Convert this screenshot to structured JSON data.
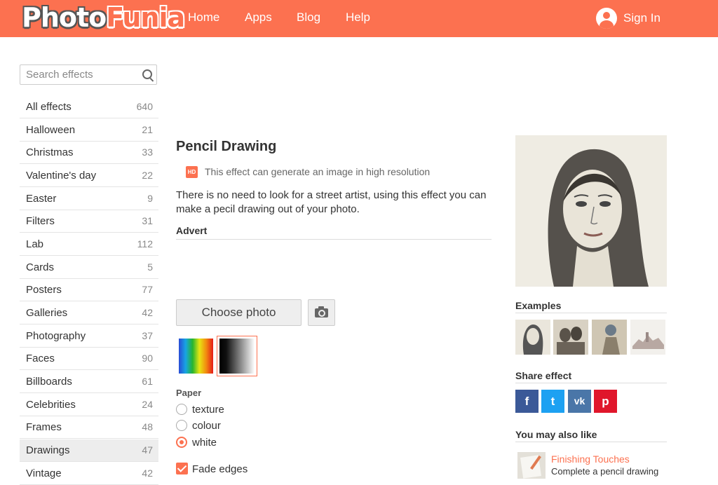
{
  "header": {
    "logo_part1": "Photo",
    "logo_part2": "Funia",
    "nav": [
      "Home",
      "Apps",
      "Blog",
      "Help"
    ],
    "signin_label": "Sign In",
    "accent_color": "#fc7150"
  },
  "sidebar": {
    "search_placeholder": "Search effects",
    "categories": [
      {
        "label": "All effects",
        "count": "640"
      },
      {
        "label": "Halloween",
        "count": "21"
      },
      {
        "label": "Christmas",
        "count": "33"
      },
      {
        "label": "Valentine's day",
        "count": "22"
      },
      {
        "label": "Easter",
        "count": "9"
      },
      {
        "label": "Filters",
        "count": "31"
      },
      {
        "label": "Lab",
        "count": "112"
      },
      {
        "label": "Cards",
        "count": "5"
      },
      {
        "label": "Posters",
        "count": "77"
      },
      {
        "label": "Galleries",
        "count": "42"
      },
      {
        "label": "Photography",
        "count": "37"
      },
      {
        "label": "Faces",
        "count": "90"
      },
      {
        "label": "Billboards",
        "count": "61"
      },
      {
        "label": "Celebrities",
        "count": "24"
      },
      {
        "label": "Frames",
        "count": "48"
      },
      {
        "label": "Drawings",
        "count": "47"
      },
      {
        "label": "Vintage",
        "count": "42"
      }
    ],
    "active_category": "Drawings"
  },
  "main": {
    "title": "Pencil Drawing",
    "hd_badge": "HD",
    "hd_text": "This effect can generate an image in high resolution",
    "description": "There is no need to look for a street artist, using this effect you can make a pecil drawing out of your photo.",
    "advert_label": "Advert",
    "choose_photo_label": "Choose photo",
    "paper_label": "Paper",
    "paper_options": [
      "texture",
      "colour",
      "white"
    ],
    "paper_selected": "white",
    "fade_edges_label": "Fade edges",
    "fade_edges_checked": true
  },
  "right": {
    "examples_title": "Examples",
    "share_title": "Share effect",
    "share_buttons": [
      {
        "name": "facebook",
        "glyph": "f",
        "color": "#3b5998"
      },
      {
        "name": "twitter",
        "glyph": "t",
        "color": "#1da1f2"
      },
      {
        "name": "vk",
        "glyph": "vk",
        "color": "#4a76a8"
      },
      {
        "name": "pinterest",
        "glyph": "p",
        "color": "#e0162b"
      }
    ],
    "also_like_title": "You may also like",
    "also_like": {
      "title": "Finishing Touches",
      "desc": "Complete a pencil drawing"
    }
  }
}
